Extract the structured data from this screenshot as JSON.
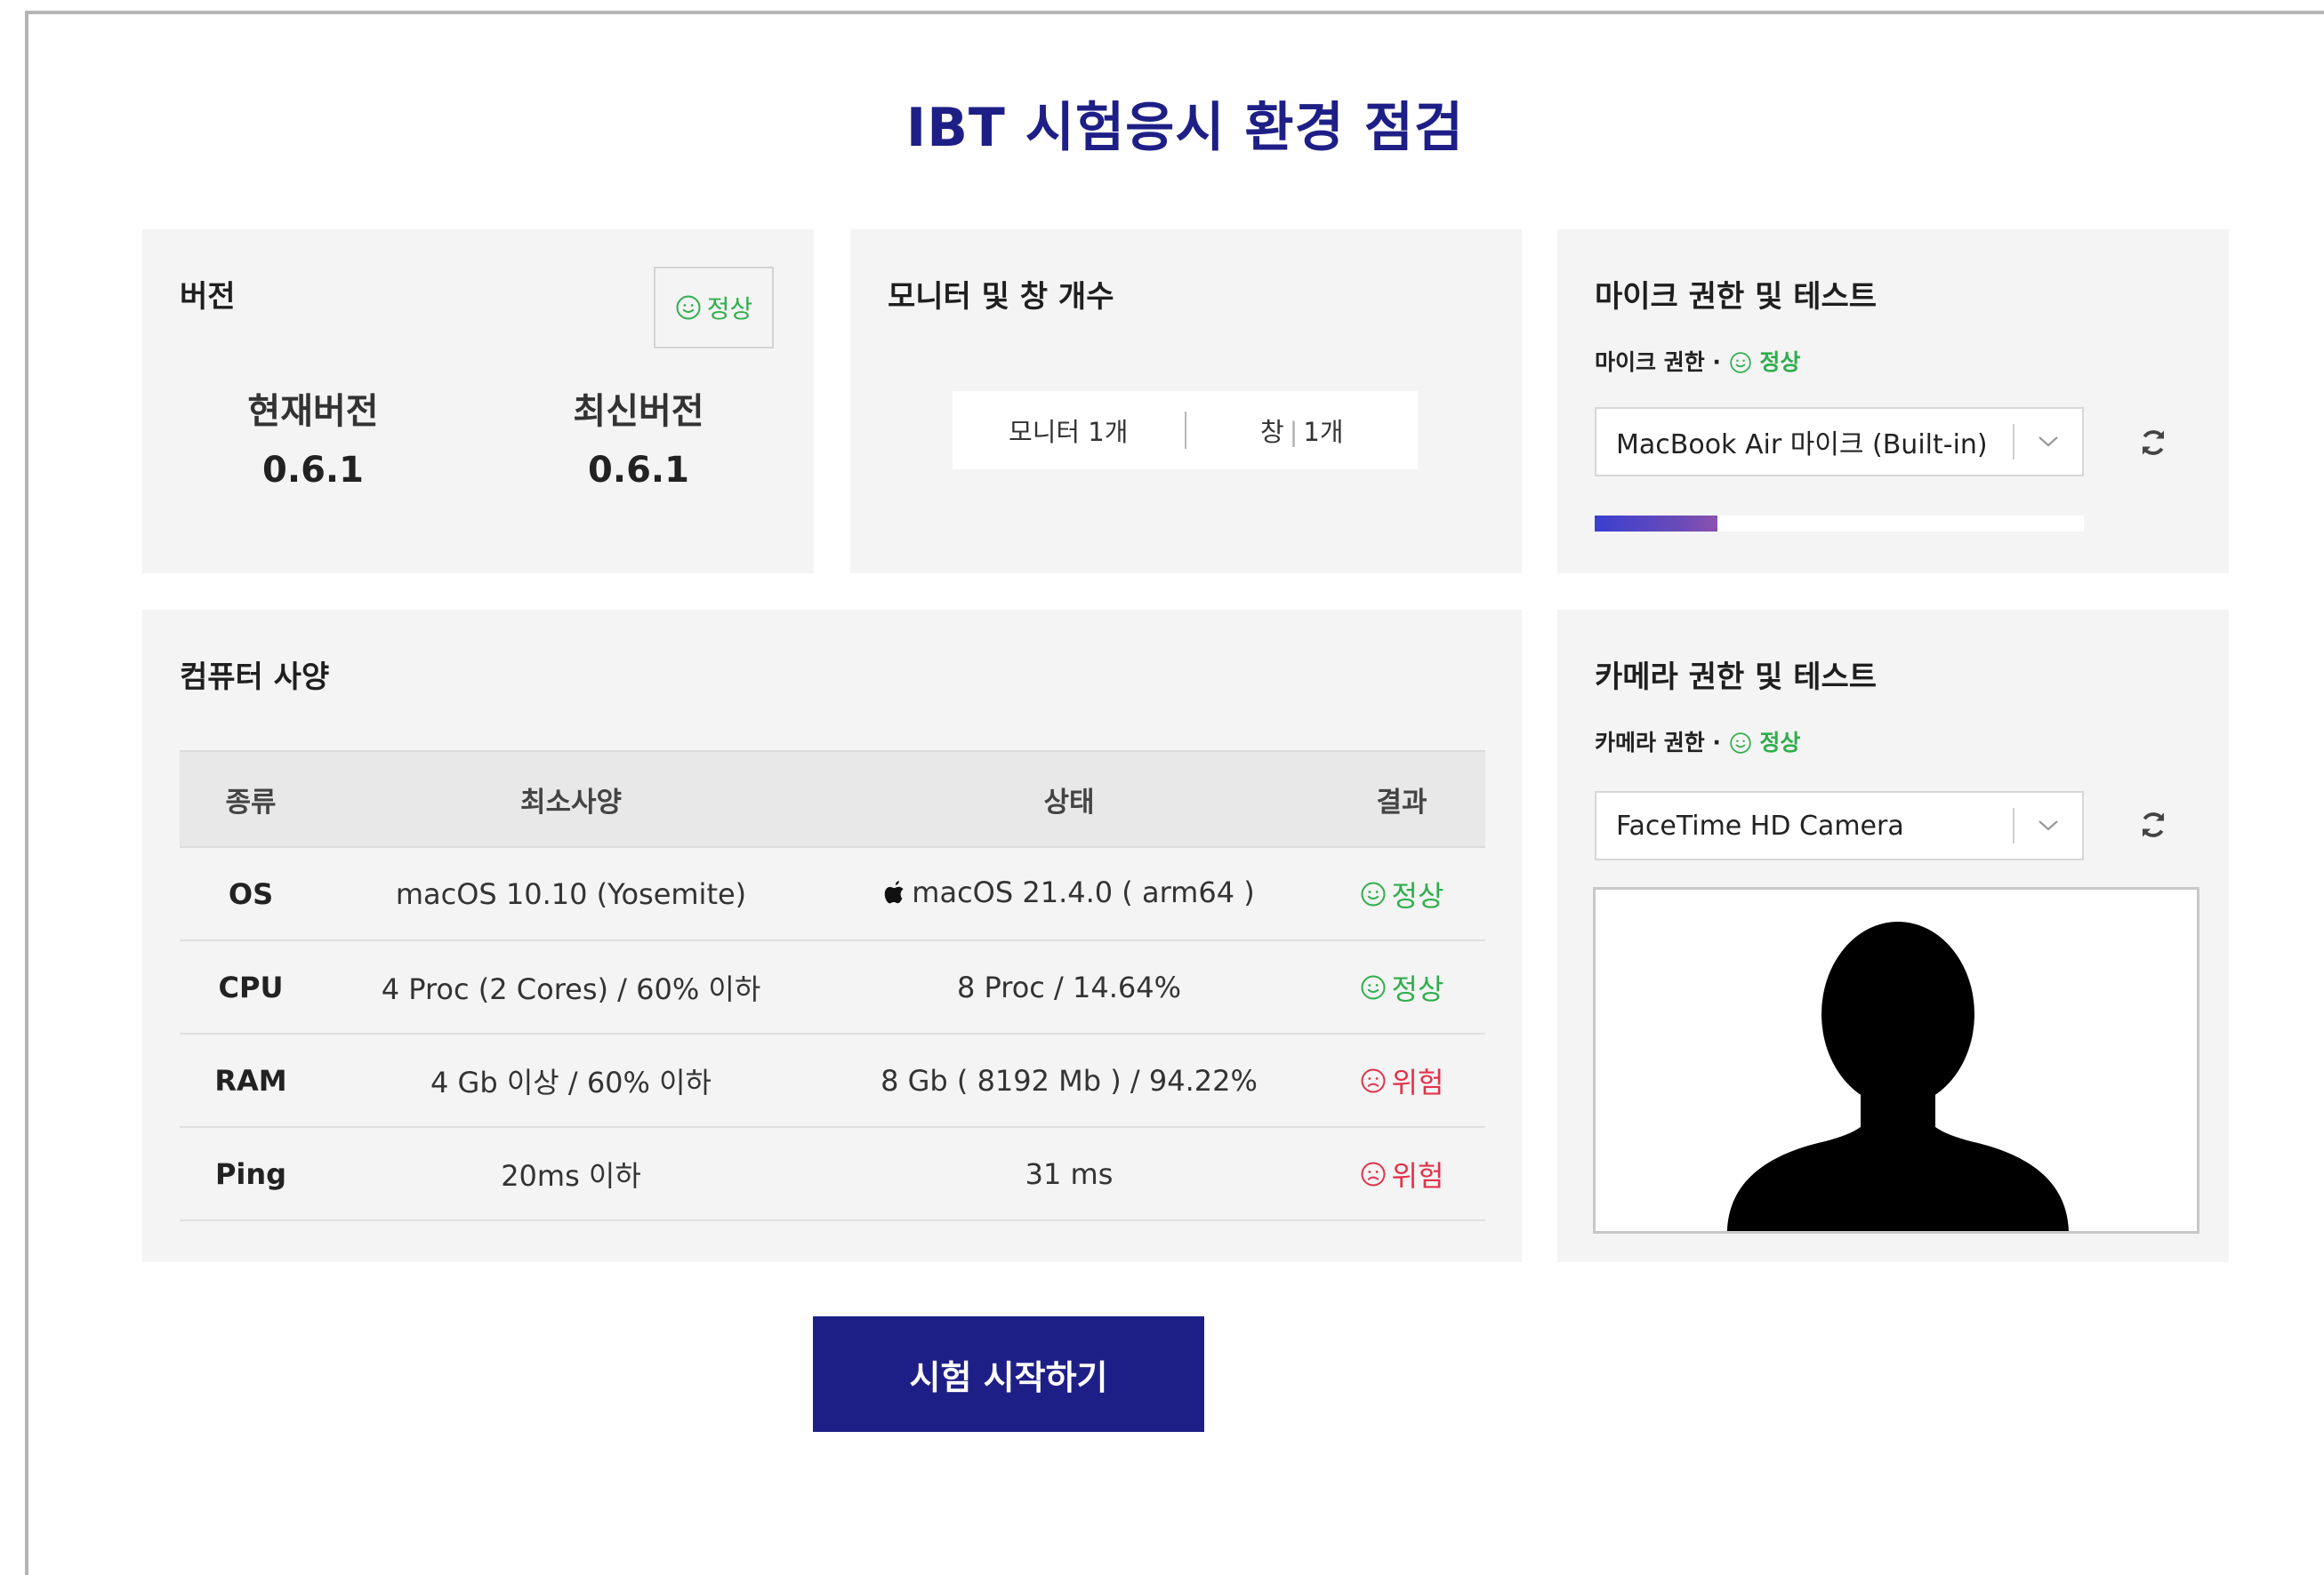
{
  "page": {
    "title": "IBT 시험응시 환경 점검"
  },
  "version": {
    "title": "버전",
    "status": "정상",
    "current_label": "현재버전",
    "current_value": "0.6.1",
    "latest_label": "최신버전",
    "latest_value": "0.6.1"
  },
  "monitor": {
    "title": "모니터 및 창 개수",
    "monitor_text": "모니터 1개",
    "window_label": "창",
    "window_sep": "|",
    "window_value": "1개"
  },
  "mic": {
    "title": "마이크 권한 및 테스트",
    "permission_label": "마이크 권한 · ",
    "permission_status": "정상",
    "device": "MacBook Air 마이크 (Built-in)",
    "level_fraction": 0.25
  },
  "spec": {
    "title": "컴퓨터 사양",
    "headers": [
      "종류",
      "최소사양",
      "상태",
      "결과"
    ],
    "rows": [
      {
        "kind": "OS",
        "minimum": "macOS 10.10 (Yosemite)",
        "status": "macOS 21.4.0 ( arm64 )",
        "result": "정상",
        "ok": true
      },
      {
        "kind": "CPU",
        "minimum": "4 Proc (2 Cores) / 60% 이하",
        "status": "8 Proc / 14.64%",
        "result": "정상",
        "ok": true
      },
      {
        "kind": "RAM",
        "minimum": "4 Gb 이상 / 60% 이하",
        "status": "8 Gb ( 8192 Mb ) / 94.22%",
        "result": "위험",
        "ok": false
      },
      {
        "kind": "Ping",
        "minimum": "20ms 이하",
        "status": "31 ms",
        "result": "위험",
        "ok": false
      }
    ]
  },
  "camera": {
    "title": "카메라 권한 및 테스트",
    "permission_label": "카메라 권한 · ",
    "permission_status": "정상",
    "device": "FaceTime HD Camera"
  },
  "actions": {
    "start_label": "시험 시작하기"
  },
  "colors": {
    "brand": "#1e1f86",
    "ok": "#2fae4c",
    "danger": "#e0334b"
  },
  "icons": {
    "ok": "smile-icon",
    "danger": "frown-icon",
    "os": "apple-icon",
    "refresh": "refresh-icon",
    "dropdown": "chevron-down-icon",
    "camera_placeholder": "person-silhouette-icon"
  }
}
